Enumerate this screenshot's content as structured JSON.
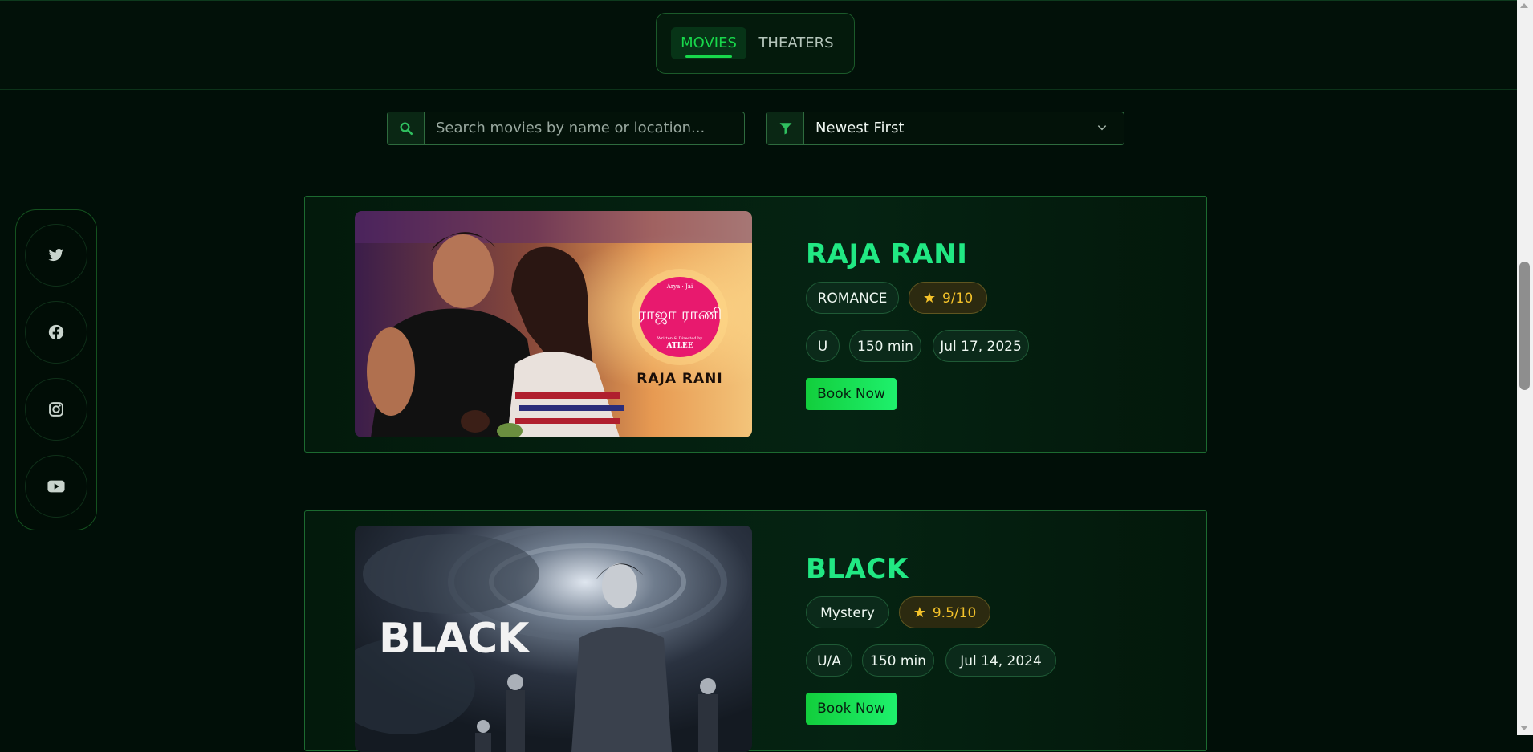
{
  "tabs": {
    "movies": "MOVIES",
    "theaters": "THEATERS"
  },
  "search": {
    "placeholder": "Search movies by name or location..."
  },
  "sort": {
    "selected": "Newest First"
  },
  "social": [
    "twitter-icon",
    "facebook-icon",
    "instagram-icon",
    "youtube-icon"
  ],
  "movies": [
    {
      "title": "RAJA RANI",
      "genre": "ROMANCE",
      "rating": "9/10",
      "certificate": "U",
      "duration": "150 min",
      "release": "Jul 17, 2025",
      "book_label": "Book Now",
      "poster": {
        "logo_top": "Arya · Jai",
        "logo_script": "ராஜா ராணி",
        "logo_credit": "Written & Directed by",
        "logo_director": "ATLEE",
        "caption": "RAJA RANI"
      }
    },
    {
      "title": "BLACK",
      "genre": "Mystery",
      "rating": "9.5/10",
      "certificate": "U/A",
      "duration": "150 min",
      "release": "Jul 14, 2024",
      "book_label": "Book Now",
      "poster": {
        "caption": "BLACK"
      }
    }
  ],
  "colors": {
    "accent": "#18d84b",
    "title": "#21e883",
    "rating": "#f4c22a"
  }
}
